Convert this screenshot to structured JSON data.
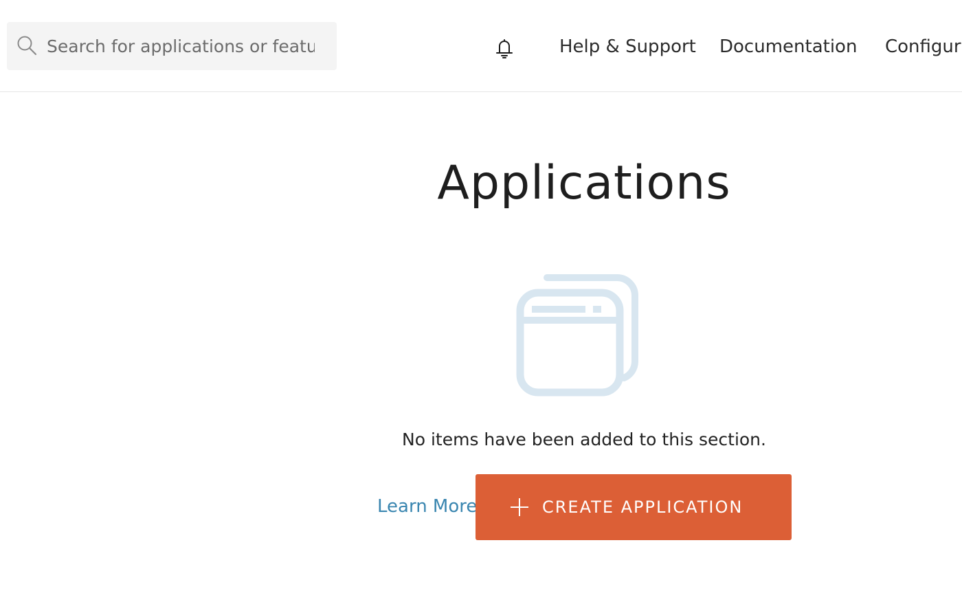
{
  "header": {
    "search": {
      "placeholder": "Search for applications or features",
      "icon": "search-icon"
    },
    "notifications_icon": "bell-icon",
    "nav": [
      {
        "label": "Help & Support"
      },
      {
        "label": "Documentation"
      },
      {
        "label": "Configura"
      }
    ]
  },
  "main": {
    "title": "Applications",
    "empty_state": {
      "icon": "application-window-icon",
      "message": "No items have been added to this section.",
      "learn_more_label": "Learn More",
      "create_button_label": "CREATE APPLICATION",
      "create_button_icon": "plus-icon"
    }
  },
  "colors": {
    "accent": "#dc5f36",
    "link": "#3a86b0",
    "illustration": "#d8e6f0",
    "search_background": "#f4f4f4"
  }
}
